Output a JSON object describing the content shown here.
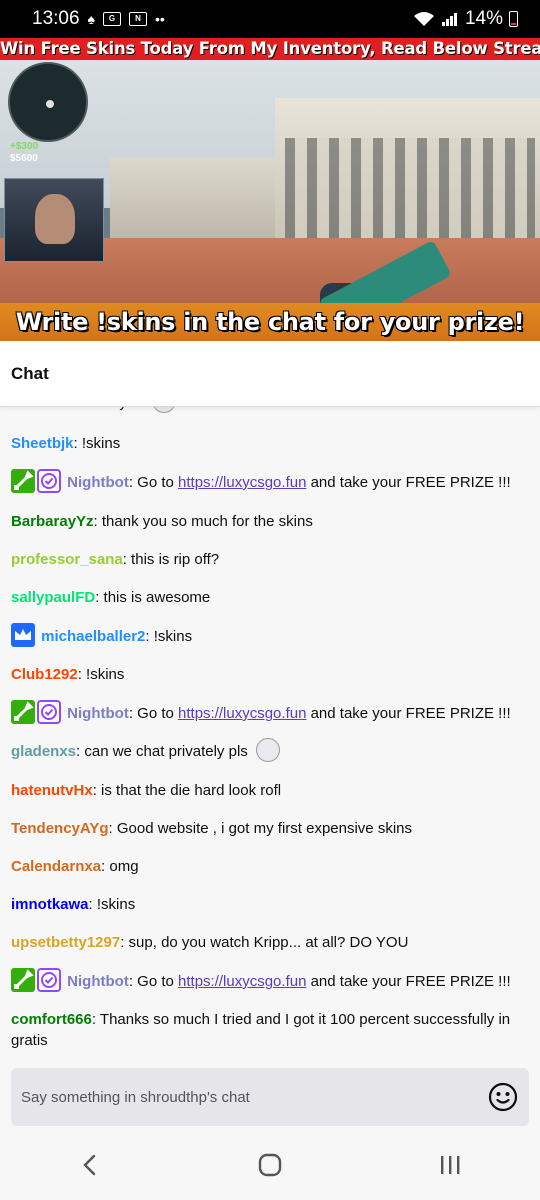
{
  "status_bar": {
    "time": "13:06",
    "battery": "14%"
  },
  "stream": {
    "top_banner": "Win Free Skins Today From My Inventory, Read Below Stream",
    "bottom_banner": "Write !skins in the chat for your prize!",
    "hud": {
      "money_gain": "+$300",
      "money": "$5600"
    }
  },
  "chat": {
    "title": "Chat",
    "messages": [
      {
        "user": "brookhd",
        "user_color": "#d2691e",
        "text": ": I love you",
        "has_emote": true
      },
      {
        "user": "Sheetbjk",
        "user_color": "#1e90ff",
        "text": ": !skins"
      },
      {
        "user": "Nightbot",
        "user_color": "#7c7cc8",
        "badges": [
          "mod",
          "verified"
        ],
        "pre": ": Go to ",
        "link": "https://luxycsgo.fun",
        "post": " and take your FREE PRIZE !!!"
      },
      {
        "user": "BarbarayYz",
        "user_color": "#008000",
        "text": ": thank you so much for the skins"
      },
      {
        "user": "professor_sana",
        "user_color": "#9acd32",
        "text": ": this is rip off?"
      },
      {
        "user": "sallypaulFD",
        "user_color": "#00ff7f",
        "text": ": this is awesome"
      },
      {
        "user": "michaelballer2",
        "user_color": "#1e90ff",
        "badges": [
          "prime"
        ],
        "text": ": !skins"
      },
      {
        "user": "Club1292",
        "user_color": "#ff4500",
        "text": ": !skins"
      },
      {
        "user": "Nightbot",
        "user_color": "#7c7cc8",
        "badges": [
          "mod",
          "verified"
        ],
        "pre": ": Go to ",
        "link": "https://luxycsgo.fun",
        "post": " and take your FREE PRIZE !!!"
      },
      {
        "user": "gladenxs",
        "user_color": "#5f9ea0",
        "text": ": can we chat privately pls",
        "has_emote": true
      },
      {
        "user": "hatenutvHx",
        "user_color": "#ff4500",
        "text": ": is that the die hard look rofl"
      },
      {
        "user": "TendencyAYg",
        "user_color": "#d2691e",
        "text": ": Good website , i got my first expensive skins"
      },
      {
        "user": "Calendarnxa",
        "user_color": "#d2691e",
        "text": ": omg"
      },
      {
        "user": "imnotkawa",
        "user_color": "#0000ff",
        "text": ": !skins"
      },
      {
        "user": "upsetbetty1297",
        "user_color": "#daa520",
        "text": ": sup, do you watch Kripp... at all? DO YOU"
      },
      {
        "user": "Nightbot",
        "user_color": "#7c7cc8",
        "badges": [
          "mod",
          "verified"
        ],
        "pre": ": Go to ",
        "link": "https://luxycsgo.fun",
        "post": " and take your FREE PRIZE !!!"
      },
      {
        "user": "comfort666",
        "user_color": "#008000",
        "text": ": Thanks so much I tried and I got it 100 percent successfully in gratis"
      }
    ],
    "input_placeholder": "Say something in shroudthp's chat"
  },
  "colors": {
    "mod_badge": "#34ae0a",
    "verified_badge": "#9146ff",
    "prime_badge": "#1f69ff",
    "link": "#5c39c6"
  },
  "icons": {
    "emoji": "smiley-face-icon",
    "nav_back": "chevron-left-icon",
    "nav_home": "rounded-square-icon",
    "nav_recents": "three-bars-icon"
  }
}
